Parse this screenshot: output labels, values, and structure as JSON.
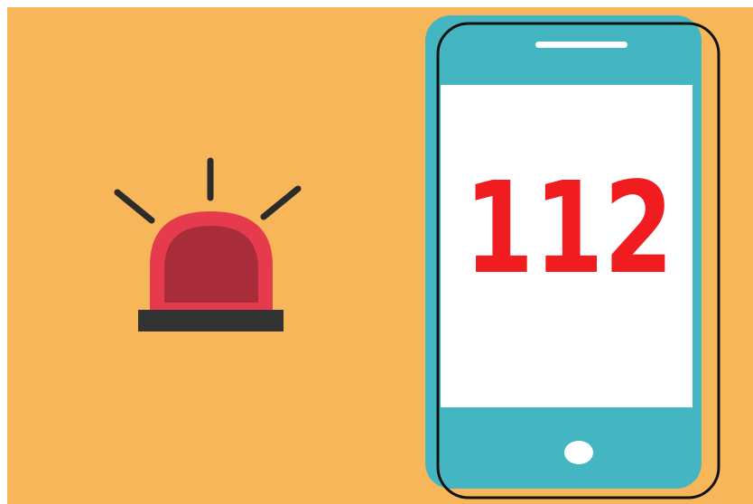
{
  "illustration": {
    "emergency_number": "112",
    "icons": {
      "siren": "siren-icon",
      "phone": "smartphone-icon"
    },
    "colors": {
      "background": "#F7B65A",
      "phone_body": "#44B6C2",
      "phone_screen": "#FFFFFF",
      "phone_outline": "#111111",
      "number": "#F01C20",
      "siren_dome": "#E63B4D",
      "siren_dome_inner": "#A82C39",
      "siren_base": "#333333",
      "siren_rays": "#2B2B2B"
    }
  }
}
